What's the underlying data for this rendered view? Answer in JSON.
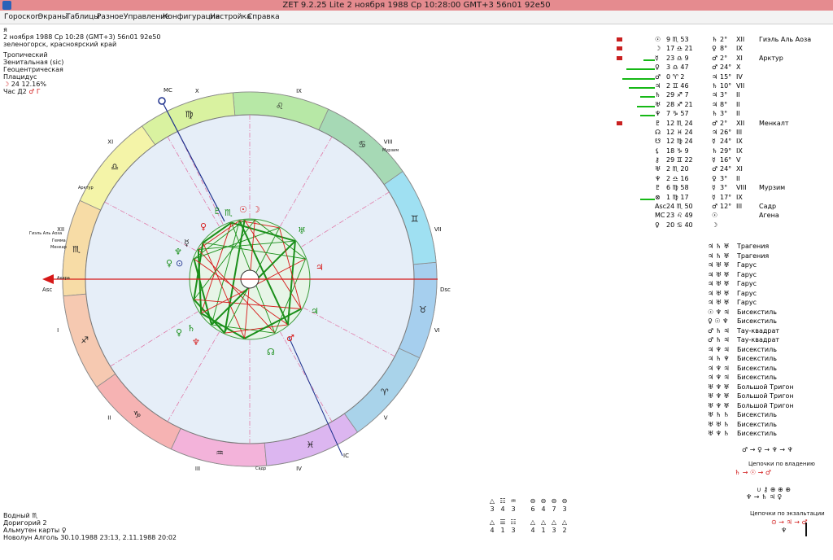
{
  "window": {
    "title": "ZET 9.2.25 Lite    2 ноября 1988  Ср  10:28:00 GMT+3 56n01  92e50"
  },
  "menu": [
    "Гороскоп",
    "Экраны",
    "Таблицы",
    "Разное",
    "Управление",
    "Конфигурация",
    "Настройка",
    "Справка"
  ],
  "info": {
    "name": "я",
    "datetime": "2 ноября 1988  Ср  10:28 (GMT+3) 56n01  92e50",
    "place": "зеленогорск, красноярский край",
    "zodiac": "Тропический",
    "coords": "Зенитальная (sic)",
    "centric": "Геоцентрическая",
    "houses": "Плацидус",
    "moon_phase": "24 12.16%",
    "hour_label": "Час Д2",
    "hour_planet": "♂ Г"
  },
  "footer": {
    "line1": "Водный   ♏",
    "line2": "Доригорий  2",
    "line3": "Альмутен карты  ♀",
    "line4": "Новолун Алголь 30.10.1988 23:13,  2.11.1988 20:02"
  },
  "angles": {
    "asc": "Asc",
    "dsc": "Dsc",
    "mc": "MC",
    "ic": "IC"
  },
  "houses": [
    "I",
    "II",
    "III",
    "IV",
    "V",
    "VI",
    "VII",
    "VIII",
    "IX",
    "X",
    "XI",
    "XII"
  ],
  "stars_on_chart": [
    "Мурзим",
    "Арктур",
    "Гиэль Аль Аоза",
    "Гемма",
    "Менкар",
    "Ахира",
    "Садр"
  ],
  "planets": [
    {
      "glyph": "☉",
      "deg": "9 ♏ 53",
      "flag": "true",
      "bar": 0,
      "ruler": "♄",
      "house_deg": "2°",
      "house": "XII",
      "star": "Гиэль Аль Аоза"
    },
    {
      "glyph": "☽",
      "deg": "17 ♎ 21",
      "flag": "true",
      "bar": 0,
      "ruler": "♀",
      "house_deg": "8°",
      "house": "IX",
      "star": ""
    },
    {
      "glyph": "☿",
      "deg": "23 ♎ 9",
      "flag": "true",
      "bar": 14,
      "ruler": "♂",
      "house_deg": "2°",
      "house": "XI",
      "star": "Арктур"
    },
    {
      "glyph": "♀",
      "deg": "3 ♎ 47",
      "flag": "false",
      "bar": 35,
      "ruler": "♂",
      "house_deg": "24°",
      "house": "X",
      "star": ""
    },
    {
      "glyph": "♂",
      "deg": "0 ♈ 2",
      "flag": "false",
      "bar": 40,
      "ruler": "♃",
      "house_deg": "15°",
      "house": "IV",
      "star": ""
    },
    {
      "glyph": "♃",
      "deg": "2 ♊ 46",
      "flag": "false",
      "bar": 32,
      "ruler": "♄",
      "house_deg": "10°",
      "house": "VII",
      "star": ""
    },
    {
      "glyph": "♄",
      "deg": "29 ♐ 7",
      "flag": "false",
      "bar": 18,
      "ruler": "♃",
      "house_deg": "3°",
      "house": "II",
      "star": ""
    },
    {
      "glyph": "♅",
      "deg": "28 ♐ 21",
      "flag": "false",
      "bar": 22,
      "ruler": "♃",
      "house_deg": "8°",
      "house": "II",
      "star": ""
    },
    {
      "glyph": "♆",
      "deg": "7 ♑ 57",
      "flag": "false",
      "bar": 18,
      "ruler": "♄",
      "house_deg": "3°",
      "house": "II",
      "star": ""
    },
    {
      "glyph": "♇",
      "deg": "12 ♏ 24",
      "flag": "true",
      "bar": 0,
      "ruler": "♂",
      "house_deg": "2°",
      "house": "XII",
      "star": "Менкалт"
    },
    {
      "glyph": "☊",
      "deg": "12 ♓ 24",
      "flag": "false",
      "bar": 0,
      "ruler": "♃",
      "house_deg": "26°",
      "house": "III",
      "star": ""
    },
    {
      "glyph": "☋",
      "deg": "12 ♍ 24",
      "flag": "false",
      "bar": 0,
      "ruler": "☿",
      "house_deg": "24°",
      "house": "IX",
      "star": ""
    },
    {
      "glyph": "⚸",
      "deg": "18 ♑ 9",
      "flag": "false",
      "bar": 0,
      "ruler": "♄",
      "house_deg": "29°",
      "house": "IX",
      "star": ""
    },
    {
      "glyph": "⚷",
      "deg": "29 ♊ 22",
      "flag": "false",
      "bar": 0,
      "ruler": "☿",
      "house_deg": "16°",
      "house": "V",
      "star": ""
    },
    {
      "glyph": "♅",
      "deg": "2 ♏ 20",
      "flag": "false",
      "bar": 0,
      "ruler": "♂",
      "house_deg": "24°",
      "house": "XI",
      "star": ""
    },
    {
      "glyph": "♆",
      "deg": "2 ♎ 16",
      "flag": "false",
      "bar": 0,
      "ruler": "♀",
      "house_deg": "3°",
      "house": "II",
      "star": ""
    },
    {
      "glyph": "♇",
      "deg": "6 ♍ 58",
      "flag": "false",
      "bar": 0,
      "ruler": "☿",
      "house_deg": "3°",
      "house": "VIII",
      "star": "Мурзим"
    },
    {
      "glyph": "⊗",
      "deg": "1 ♍ 17",
      "flag": "false",
      "bar": 18,
      "ruler": "☿",
      "house_deg": "17°",
      "house": "IX",
      "star": ""
    },
    {
      "glyph": "Asc",
      "deg": "24 ♏ 50",
      "flag": "false",
      "bar": 0,
      "ruler": "♂",
      "house_deg": "12°",
      "house": "III",
      "star": "Садр"
    },
    {
      "glyph": "MC",
      "deg": "23 ♌ 49",
      "flag": "false",
      "bar": 0,
      "ruler": "☉",
      "house_deg": "",
      "house": "",
      "star": "Агена"
    },
    {
      "glyph": "♀",
      "deg": "20 ♋ 40",
      "flag": "false",
      "bar": 0,
      "ruler": "☽",
      "house_deg": "",
      "house": "",
      "star": ""
    }
  ],
  "aspects": [
    {
      "g": "♃ ♄ ♅",
      "name": "Трагения"
    },
    {
      "g": "♃ ♄ ♅",
      "name": "Трагения"
    },
    {
      "g": "♃ ♅ ♅",
      "name": "Гарус"
    },
    {
      "g": "♃ ♅ ♅",
      "name": "Гарус"
    },
    {
      "g": "♃ ♅ ♅",
      "name": "Гарус"
    },
    {
      "g": "♃ ♅ ♅",
      "name": "Гарус"
    },
    {
      "g": "♃ ♅ ♅",
      "name": "Гарус"
    },
    {
      "g": "☉ ♆ ♃",
      "name": "Бисекстиль"
    },
    {
      "g": "♀ ☉ ♆",
      "name": "Бисекстиль"
    },
    {
      "g": "♂ ♄ ♃",
      "name": "Тау-квадрат"
    },
    {
      "g": "♂ ♄ ♃",
      "name": "Тау-квадрат"
    },
    {
      "g": "♃ ♆ ♃",
      "name": "Бисекстиль"
    },
    {
      "g": "♃ ♄ ♆",
      "name": "Бисекстиль"
    },
    {
      "g": "♃ ♆ ♃",
      "name": "Бисекстиль"
    },
    {
      "g": "♃ ♆ ♃",
      "name": "Бисекстиль"
    },
    {
      "g": "♅ ♆ ♅",
      "name": "Большой Тригон"
    },
    {
      "g": "♅ ♆ ♅",
      "name": "Большой Тригон"
    },
    {
      "g": "♅ ♆ ♅",
      "name": "Большой Тригон"
    },
    {
      "g": "♅ ♄ ♄",
      "name": "Бисекстиль"
    },
    {
      "g": "♅ ♅ ♄",
      "name": "Бисекстиль"
    },
    {
      "g": "♅ ♆ ♄",
      "name": "Бисекстиль"
    }
  ],
  "chains": {
    "formula": "♂ → ♀ → ♆ → ♆",
    "disp_title": "Цепочки по владению",
    "disp_1": "♄ → ☉ → ♂",
    "exalt_title": "Цепочки по экзальтации"
  },
  "stats": {
    "elements_glyphs": [
      "△",
      "☷",
      "♒"
    ],
    "elements_top": [
      "3",
      "4",
      "3"
    ],
    "cross_glyphs": [
      "⊖",
      "⊖",
      "⊖",
      "⊖"
    ],
    "cross_top": [
      "6",
      "4",
      "7",
      "3"
    ],
    "elements_bot_glyphs": [
      "△",
      "☰",
      "☷"
    ],
    "elements_bot": [
      "4",
      "1",
      "3"
    ],
    "cross_bot_glyphs": [
      "△",
      "△",
      "△",
      "△"
    ],
    "cross_bot": [
      "4",
      "1",
      "3",
      "2"
    ]
  }
}
